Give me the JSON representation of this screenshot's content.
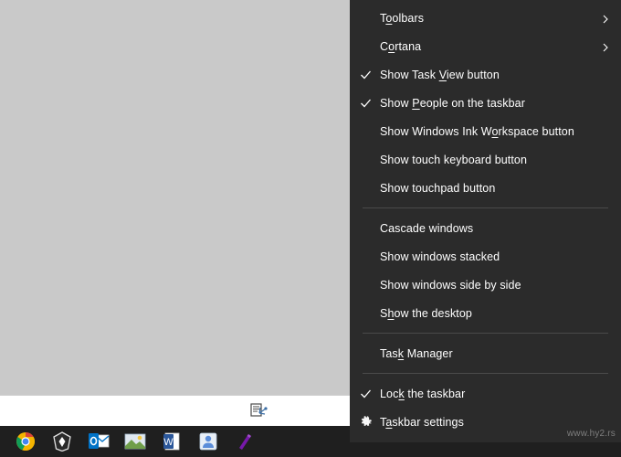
{
  "context_menu": {
    "groups": [
      {
        "items": [
          {
            "label_pre": "T",
            "label_underline": "o",
            "label_post": "olbars",
            "label": "Toolbars",
            "icon": "chevron-right-icon",
            "submenu": true,
            "checked": false
          },
          {
            "label_pre": "C",
            "label_underline": "o",
            "label_post": "rtana",
            "label": "Cortana",
            "icon": "chevron-right-icon",
            "submenu": true,
            "checked": false
          },
          {
            "label_pre": "Show Task ",
            "label_underline": "V",
            "label_post": "iew button",
            "label": "Show Task View button",
            "icon": "check-icon",
            "submenu": false,
            "checked": true
          },
          {
            "label_pre": "Show ",
            "label_underline": "P",
            "label_post": "eople on the taskbar",
            "label": "Show People on the taskbar",
            "icon": "check-icon",
            "submenu": false,
            "checked": true
          },
          {
            "label_pre": "Show Windows Ink W",
            "label_underline": "o",
            "label_post": "rkspace button",
            "label": "Show Windows Ink Workspace button",
            "icon": "",
            "submenu": false,
            "checked": false
          },
          {
            "label_pre": "Show touch keyboard button",
            "label_underline": "",
            "label_post": "",
            "label": "Show touch keyboard button",
            "icon": "",
            "submenu": false,
            "checked": false
          },
          {
            "label_pre": "Show touchpad button",
            "label_underline": "",
            "label_post": "",
            "label": "Show touchpad button",
            "icon": "",
            "submenu": false,
            "checked": false
          }
        ]
      },
      {
        "items": [
          {
            "label_pre": "Cascade windows",
            "label_underline": "",
            "label_post": "",
            "label": "Cascade windows",
            "icon": "",
            "submenu": false,
            "checked": false
          },
          {
            "label_pre": "Show windows stacked",
            "label_underline": "",
            "label_post": "",
            "label": "Show windows stacked",
            "icon": "",
            "submenu": false,
            "checked": false
          },
          {
            "label_pre": "Show windows side by side",
            "label_underline": "",
            "label_post": "",
            "label": "Show windows side by side",
            "icon": "",
            "submenu": false,
            "checked": false
          },
          {
            "label_pre": "S",
            "label_underline": "h",
            "label_post": "ow the desktop",
            "label": "Show the desktop",
            "icon": "",
            "submenu": false,
            "checked": false
          }
        ]
      },
      {
        "items": [
          {
            "label_pre": "Tas",
            "label_underline": "k",
            "label_post": " Manager",
            "label": "Task Manager",
            "icon": "",
            "submenu": false,
            "checked": false
          }
        ]
      },
      {
        "items": [
          {
            "label_pre": "Loc",
            "label_underline": "k",
            "label_post": " the taskbar",
            "label": "Lock the taskbar",
            "icon": "check-icon",
            "submenu": false,
            "checked": true
          },
          {
            "label_pre": "T",
            "label_underline": "a",
            "label_post": "skbar settings",
            "label": "Taskbar settings",
            "icon": "gear-icon",
            "submenu": false,
            "checked": false
          }
        ]
      }
    ]
  },
  "taskbar": {
    "items": [
      {
        "name": "chrome-icon",
        "title": "Google Chrome"
      },
      {
        "name": "brave-icon",
        "title": "Brave"
      },
      {
        "name": "outlook-icon",
        "title": "Outlook"
      },
      {
        "name": "photos-icon",
        "title": "Photos"
      },
      {
        "name": "word-icon",
        "title": "Word"
      },
      {
        "name": "teams-icon",
        "title": "Teams"
      },
      {
        "name": "onenote-icon",
        "title": "OneNote"
      }
    ]
  },
  "desktop": {
    "strip_icon": "scan-document-icon"
  },
  "watermark": {
    "text": "www.hy2.rs"
  },
  "colors": {
    "menu_background": "#2b2b2b",
    "menu_text": "#ffffff",
    "separator": "#4a4a4a",
    "taskbar": "#1f1f1f",
    "desktop": "#c9c9c9"
  }
}
